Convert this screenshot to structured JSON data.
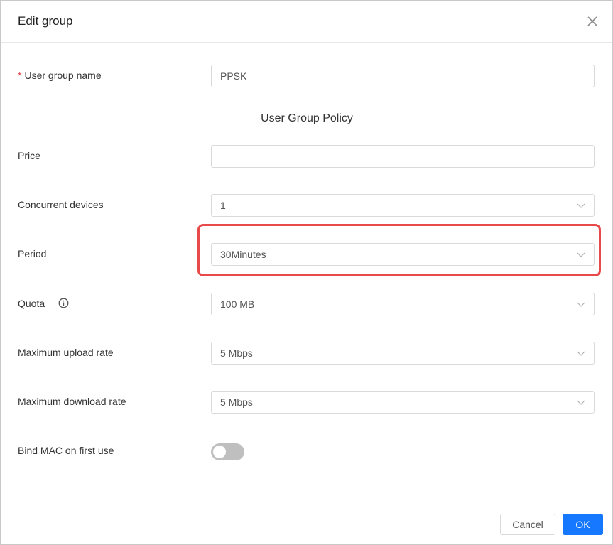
{
  "dialog": {
    "title": "Edit group"
  },
  "form": {
    "group_name": {
      "label": "User group name",
      "required_mark": "*",
      "value": "PPSK"
    },
    "section_title": "User Group Policy",
    "price": {
      "label": "Price",
      "value": ""
    },
    "concurrent_devices": {
      "label": "Concurrent devices",
      "value": "1"
    },
    "period": {
      "label": "Period",
      "value": "30Minutes"
    },
    "quota": {
      "label": "Quota",
      "value": "100 MB"
    },
    "max_upload": {
      "label": "Maximum upload rate",
      "value": "5 Mbps"
    },
    "max_download": {
      "label": "Maximum download rate",
      "value": "5 Mbps"
    },
    "bind_mac": {
      "label": "Bind MAC on first use",
      "enabled": false
    }
  },
  "footer": {
    "cancel_label": "Cancel",
    "ok_label": "OK"
  },
  "colors": {
    "primary": "#1677ff",
    "highlight": "#e84a4a",
    "required": "#e0393e"
  }
}
